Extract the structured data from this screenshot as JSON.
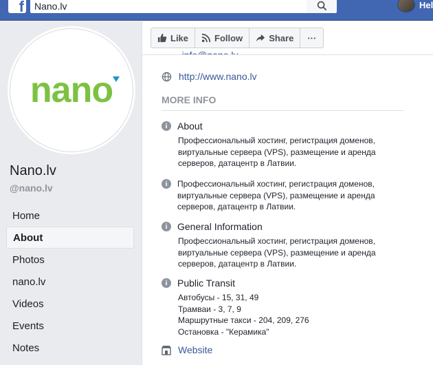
{
  "topbar": {
    "logo_letter": "f",
    "search_value": "Nano.lv",
    "search_icon": "search-icon",
    "user_name": "Hel",
    "brand_color": "#4267b2"
  },
  "profile": {
    "logo_text": "nano",
    "logo_color": "#7cc242",
    "page_name": "Nano.lv",
    "page_handle": "@nano.lv"
  },
  "nav": {
    "items": [
      {
        "label": "Home"
      },
      {
        "label": "About"
      },
      {
        "label": "Photos"
      },
      {
        "label": "nano.lv"
      },
      {
        "label": "Videos"
      },
      {
        "label": "Events"
      },
      {
        "label": "Notes"
      }
    ],
    "active": "About"
  },
  "actions": {
    "like": "Like",
    "follow": "Follow",
    "share": "Share",
    "more": "···"
  },
  "contact": {
    "email_partial": "info@nano.lv",
    "url": "http://www.nano.lv"
  },
  "more_info": {
    "title": "MORE INFO",
    "about_label": "About",
    "about_text": "Профессиональный хостинг, регистрация доменов, виртуальные сервера (VPS), размещение и аренда серверов, датацентр в Латвии.",
    "second_text": "Профессиональный хостинг, регистрация доменов, виртуальные сервера (VPS), размещение и аренда серверов, датацентр в Латвии.",
    "general_label": "General Information",
    "general_text": "Профессиональный хостинг, регистрация доменов, виртуальные сервера (VPS), размещение и аренда серверов, датацентр в Латвии.",
    "transit_label": "Public Transit",
    "transit_lines": [
      "Автобусы - 15, 31, 49",
      "Трамваи - 3, 7, 9",
      "Маршрутные такси - 204, 209, 276",
      "Остановка - \"Керамика\""
    ],
    "website_label": "Website"
  }
}
